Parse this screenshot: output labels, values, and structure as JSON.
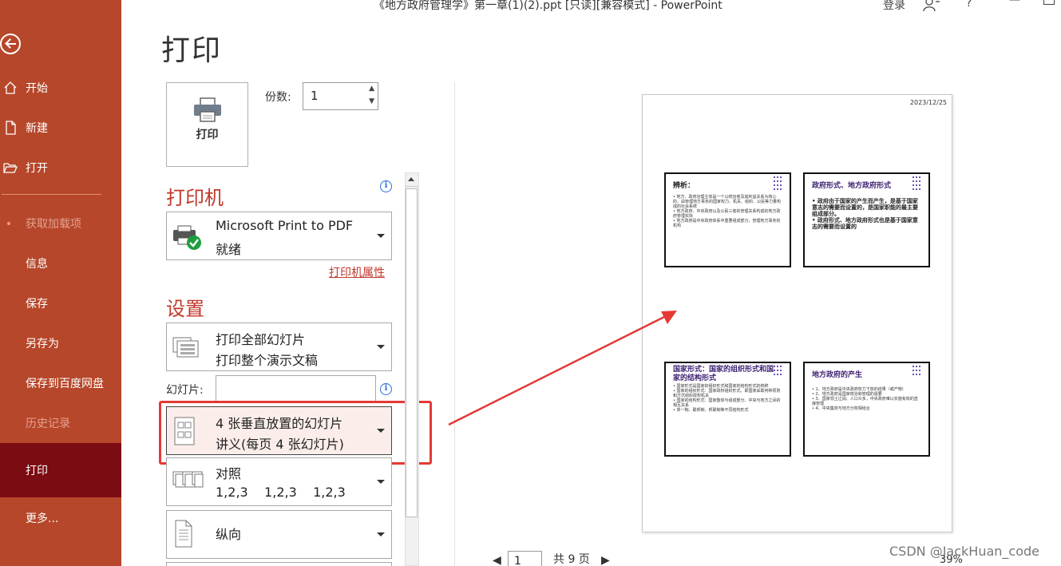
{
  "titlebar": {
    "document_title": "《地方政府管理学》第一章(1)(2).ppt [只读][兼容模式]  -  PowerPoint",
    "login_label": "登录",
    "help_label": "?",
    "minimize_label": "—"
  },
  "sidebar": {
    "items": [
      {
        "label": "开始"
      },
      {
        "label": "新建"
      },
      {
        "label": "打开"
      },
      {
        "label": "获取加载项"
      },
      {
        "label": "信息"
      },
      {
        "label": "保存"
      },
      {
        "label": "另存为"
      },
      {
        "label": "保存到百度网盘"
      },
      {
        "label": "历史记录"
      },
      {
        "label": "打印"
      },
      {
        "label": "更多..."
      }
    ]
  },
  "main": {
    "title": "打印",
    "print_button_label": "打印",
    "copies_label": "份数:",
    "copies_value": "1",
    "printer_heading": "打印机",
    "printer": {
      "name": "Microsoft Print to PDF",
      "status": "就绪"
    },
    "printer_properties_link": "打印机属性",
    "settings_heading": "设置",
    "slide_range": {
      "line1": "打印全部幻灯片",
      "line2": "打印整个演示文稿"
    },
    "slides_label": "幻灯片:",
    "slides_value": "",
    "layout": {
      "line1": "4 张垂直放置的幻灯片",
      "line2": "讲义(每页 4 张幻灯片)"
    },
    "collation": {
      "line1": "对照",
      "line2": "1,2,3    1,2,3    1,2,3"
    },
    "orientation": {
      "label": "纵向"
    }
  },
  "preview": {
    "date": "2023/12/25",
    "slides": [
      {
        "title": "辨析：",
        "bullets": [
          "地方、政府治理主体是一个以统治者及其利益关系为核心的、由管理地方事务的国家权力、机关、组织、公民等力量构成的社会系统",
          "地方政府、中央政府以及公民三者的管理关系构成的地方政府管理实际",
          "地方政府是中央政府体系中重要组成部分，管理地方事务的机构"
        ]
      },
      {
        "title": "政府形式、地方政府形式",
        "bullets": [
          "政府由于国家的产生而产生，是基于国家意志的需要而设置的，是国家职能的最主要组成部分。",
          "政府形式、地方政府形式也是基于国家意志的需要而设置的"
        ]
      },
      {
        "title": "国家形式：国家的组织形式和国家的结构形式",
        "bullets": [
          "国家形式是国家的组织形式和国家的结构形式的统称",
          "国家的组织形式：国家政权组织形式，即国家采取何种原则和方式组织政权机关",
          "国家的结构形式：国家整体与组成部分、中央与地方之间的相互关系",
          "单一制、联邦制、邦联制等不同结构形式"
        ]
      },
      {
        "title": "地方政府的产生",
        "bullets": [
          "1、地方政府是中央政府权力下放的结果（或产物）",
          "2、地方政府是国家统治和管理的需要",
          "3、国家领土辽阔、人口众多，中央政府难以实施有效的直接管理",
          "4、中央集权与地方分权相结合"
        ]
      }
    ],
    "page_current": "1",
    "page_total": "共 9 页",
    "zoom": "39%"
  },
  "watermark": "CSDN @JackHuan_code"
}
